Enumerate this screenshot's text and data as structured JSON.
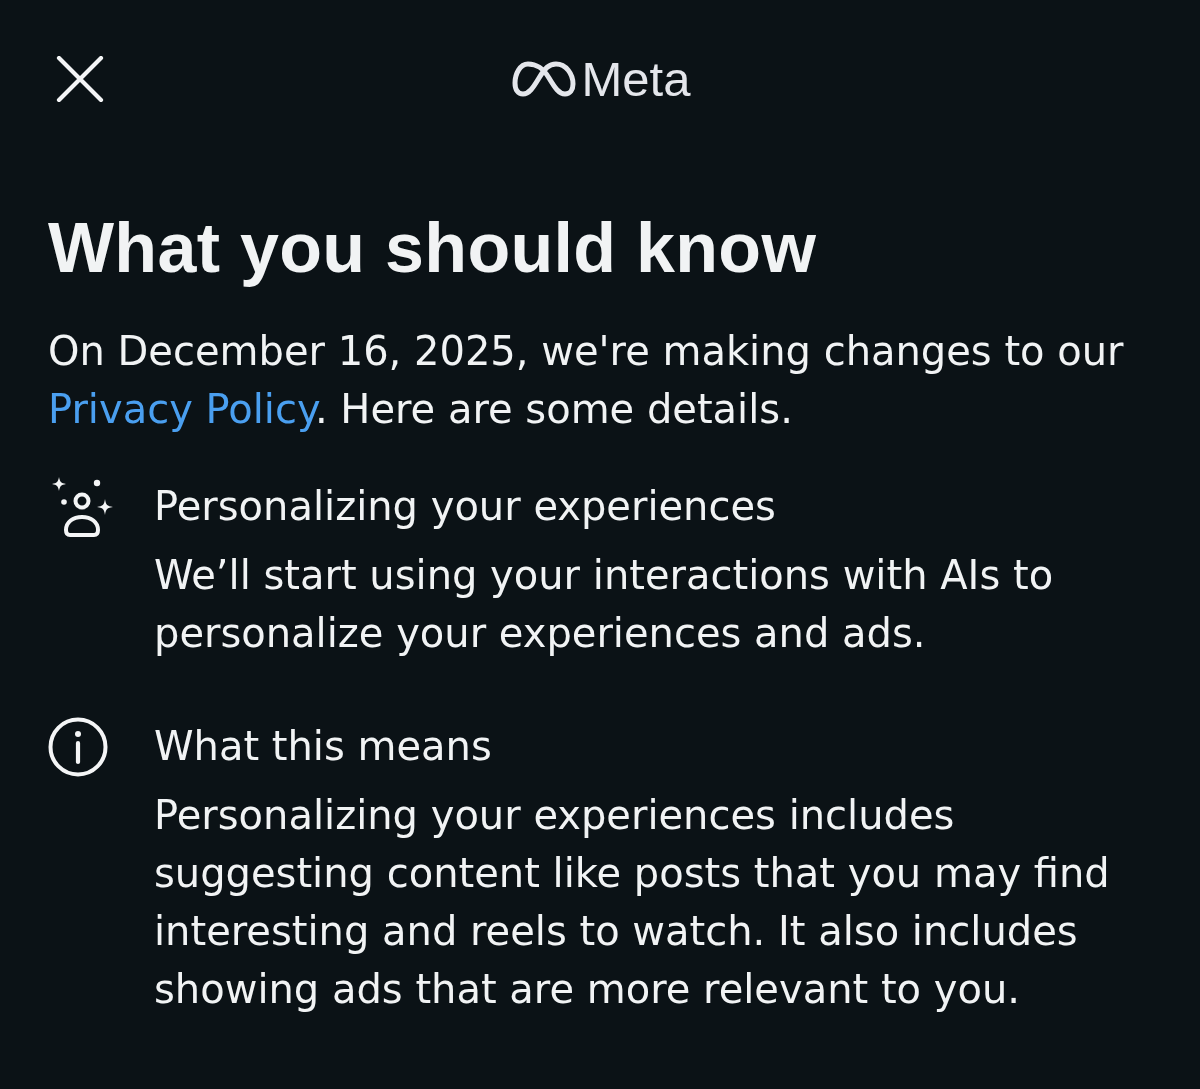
{
  "header": {
    "logo_text": "Meta"
  },
  "title": "What you should know",
  "intro": {
    "before": "On December 16, 2025, we're making changes to our",
    "link": "Privacy Policy",
    "after": ". Here are some details."
  },
  "items": [
    {
      "kind": "sparkle-person",
      "heading": "Personalizing your experiences",
      "body": "We’ll start using your interactions with AIs to personalize your experiences and ads."
    },
    {
      "kind": "info",
      "heading": "What this means",
      "body": "Personalizing your experiences includes suggesting content like posts that you may find interesting and reels to watch. It also includes showing ads that are more relevant to you."
    }
  ]
}
